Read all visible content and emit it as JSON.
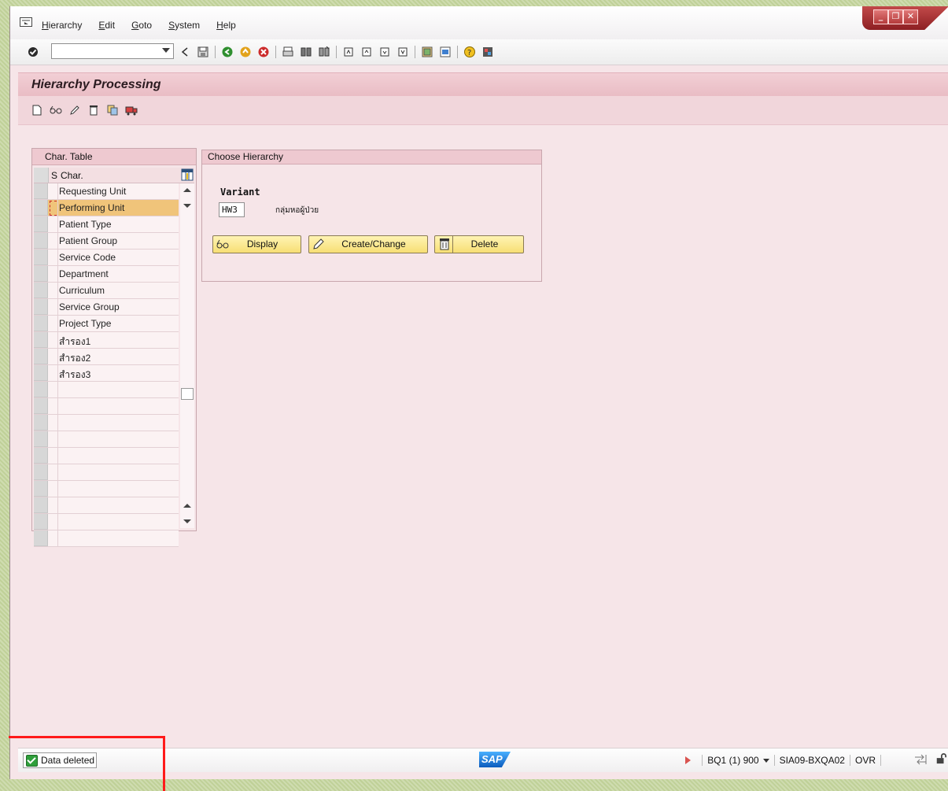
{
  "menu": {
    "items": [
      "Hierarchy",
      "Edit",
      "Goto",
      "System",
      "Help"
    ]
  },
  "window_controls": {
    "minimize": "_",
    "restore": "❐",
    "close": "✕"
  },
  "command_field": {
    "value": ""
  },
  "title": "Hierarchy Processing",
  "char_table": {
    "title": "Char. Table",
    "columns": {
      "s": "S",
      "char": "Char."
    },
    "rows": [
      "Requesting Unit",
      "Performing Unit",
      "Patient Type",
      "Patient Group",
      "Service Code",
      "Department",
      "Curriculum",
      "Service Group",
      "Project Type",
      "สำรอง1",
      "สำรอง2",
      "สำรอง3",
      "",
      "",
      "",
      "",
      "",
      "",
      "",
      "",
      "",
      ""
    ],
    "selected_index": 1
  },
  "choose": {
    "title": "Choose Hierarchy",
    "variant_label": "Variant",
    "variant_value": "HW3",
    "variant_desc": "กลุ่มหอผู้ป่วย",
    "buttons": {
      "display": "Display",
      "create_change": "Create/Change",
      "delete": "Delete"
    }
  },
  "status": {
    "message": "Data deleted",
    "logo": "SAP",
    "system": "BQ1 (1) 900",
    "server": "SIA09-BXQA02",
    "mode": "OVR"
  },
  "colors": {
    "accent": "#e9bcc4",
    "button": "#f7df74",
    "selected_row": "#f0c47a",
    "highlight_frame": "#ff1a1a"
  }
}
